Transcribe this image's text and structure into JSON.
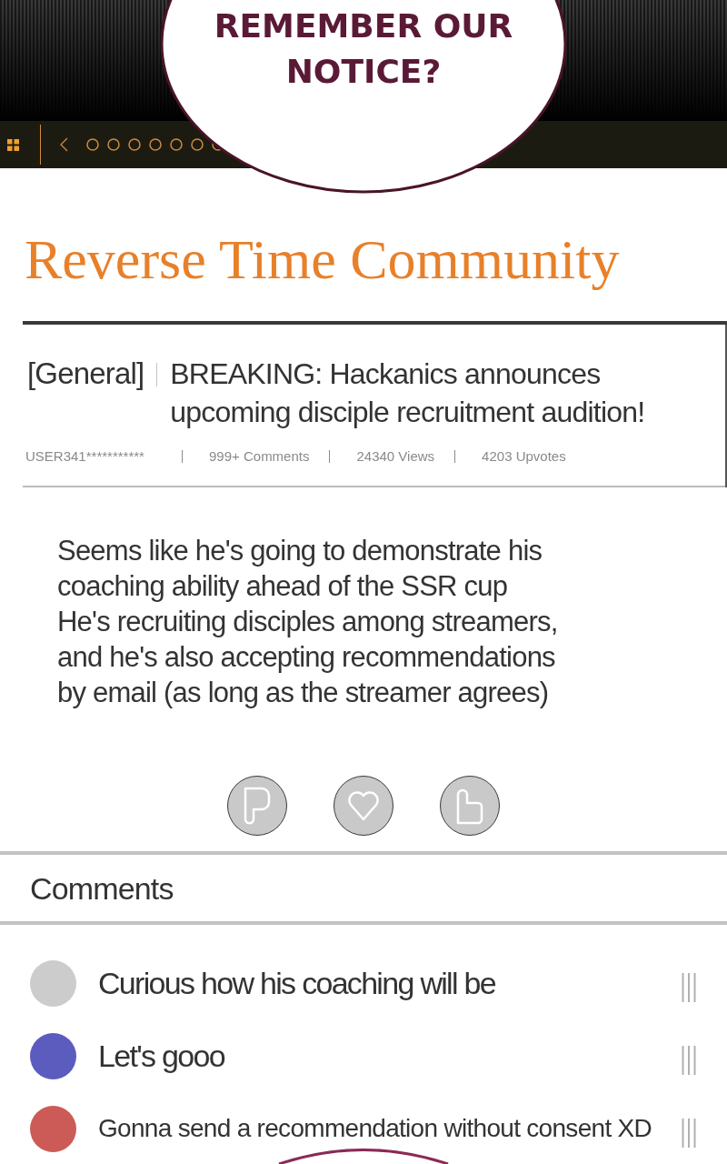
{
  "speech_bubble": {
    "text": "REMEMBER OUR NOTICE?"
  },
  "community": {
    "title": "Reverse Time Community"
  },
  "post": {
    "category": "[General]",
    "title": "BREAKING: Hackanics announces upcoming disciple recruitment audition!",
    "author": "USER341***********",
    "stats": [
      "999+ Comments",
      "24340 Views",
      "4203 Upvotes"
    ],
    "body": [
      "Seems like he's going to demonstrate his coaching ability ahead of the SSR cup",
      "He's recruiting disciples among streamers, and he's also accepting recommendations by email (as long as the streamer agrees)"
    ]
  },
  "comments": {
    "heading": "Comments",
    "items": [
      {
        "text": "Curious how his coaching will be",
        "color": "#cccccc"
      },
      {
        "text": "Let's gooo",
        "color": "#5c5cbf"
      },
      {
        "text": "Gonna send a recommendation without consent XD",
        "color": "#cc5b57"
      }
    ]
  }
}
